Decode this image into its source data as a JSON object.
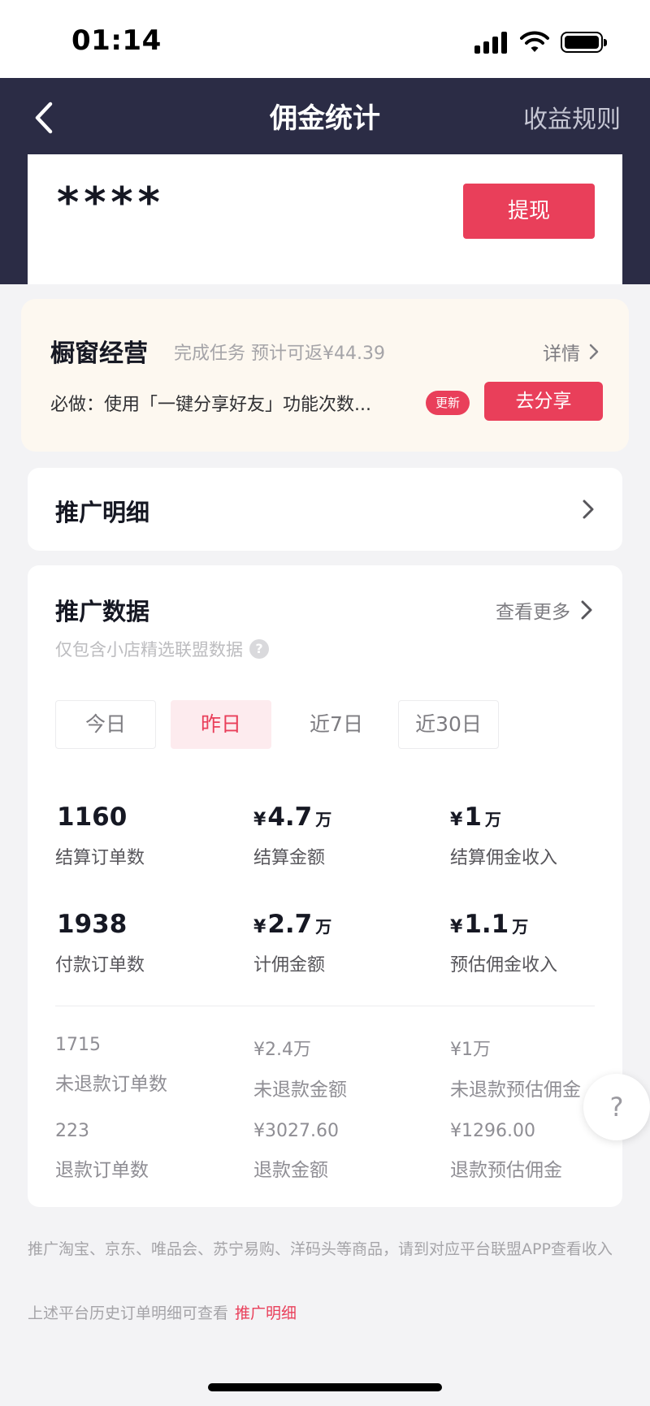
{
  "status_bar": {
    "time": "01:14"
  },
  "header": {
    "title": "佣金统计",
    "rules_link": "收益规则"
  },
  "balance": {
    "value": "****",
    "withdraw_label": "提现"
  },
  "task": {
    "title": "橱窗经营",
    "description": "完成任务 预计可返¥44.39",
    "details_label": "详情",
    "requirement": "必做：使用「一键分享好友」功能次数...",
    "badge": "更新",
    "action_label": "去分享"
  },
  "promo_detail": {
    "title": "推广明细"
  },
  "promo_data": {
    "title": "推广数据",
    "more_label": "查看更多",
    "note": "仅包含小店精选联盟数据",
    "tabs": [
      "今日",
      "昨日",
      "近7日",
      "近30日"
    ],
    "active_tab": "昨日",
    "main_stats": [
      {
        "currency": "",
        "value": "1160",
        "unit": "",
        "label": "结算订单数"
      },
      {
        "currency": "¥",
        "value": "4.7",
        "unit": "万",
        "label": "结算金额"
      },
      {
        "currency": "¥",
        "value": "1",
        "unit": "万",
        "label": "结算佣金收入"
      },
      {
        "currency": "",
        "value": "1938",
        "unit": "",
        "label": "付款订单数"
      },
      {
        "currency": "¥",
        "value": "2.7",
        "unit": "万",
        "label": "计佣金额"
      },
      {
        "currency": "¥",
        "value": "1.1",
        "unit": "万",
        "label": "预估佣金收入"
      }
    ],
    "minor_stats": [
      {
        "value": "1715",
        "label": "未退款订单数"
      },
      {
        "value": "¥2.4万",
        "label": "未退款金额"
      },
      {
        "value": "¥1万",
        "label": "未退款预估佣金"
      },
      {
        "value": "223",
        "label": "退款订单数"
      },
      {
        "value": "¥3027.60",
        "label": "退款金额"
      },
      {
        "value": "¥1296.00",
        "label": "退款预估佣金"
      }
    ]
  },
  "help_button": "?",
  "footer": {
    "line1": "推广淘宝、京东、唯品会、苏宁易购、洋码头等商品，请到对应平台联盟APP查看收入",
    "line2": "上述平台历史订单明细可查看",
    "link": "推广明细"
  },
  "colors": {
    "accent": "#e93f5a",
    "header_bg": "#2b2c45",
    "task_bg": "#fdf8f0"
  }
}
